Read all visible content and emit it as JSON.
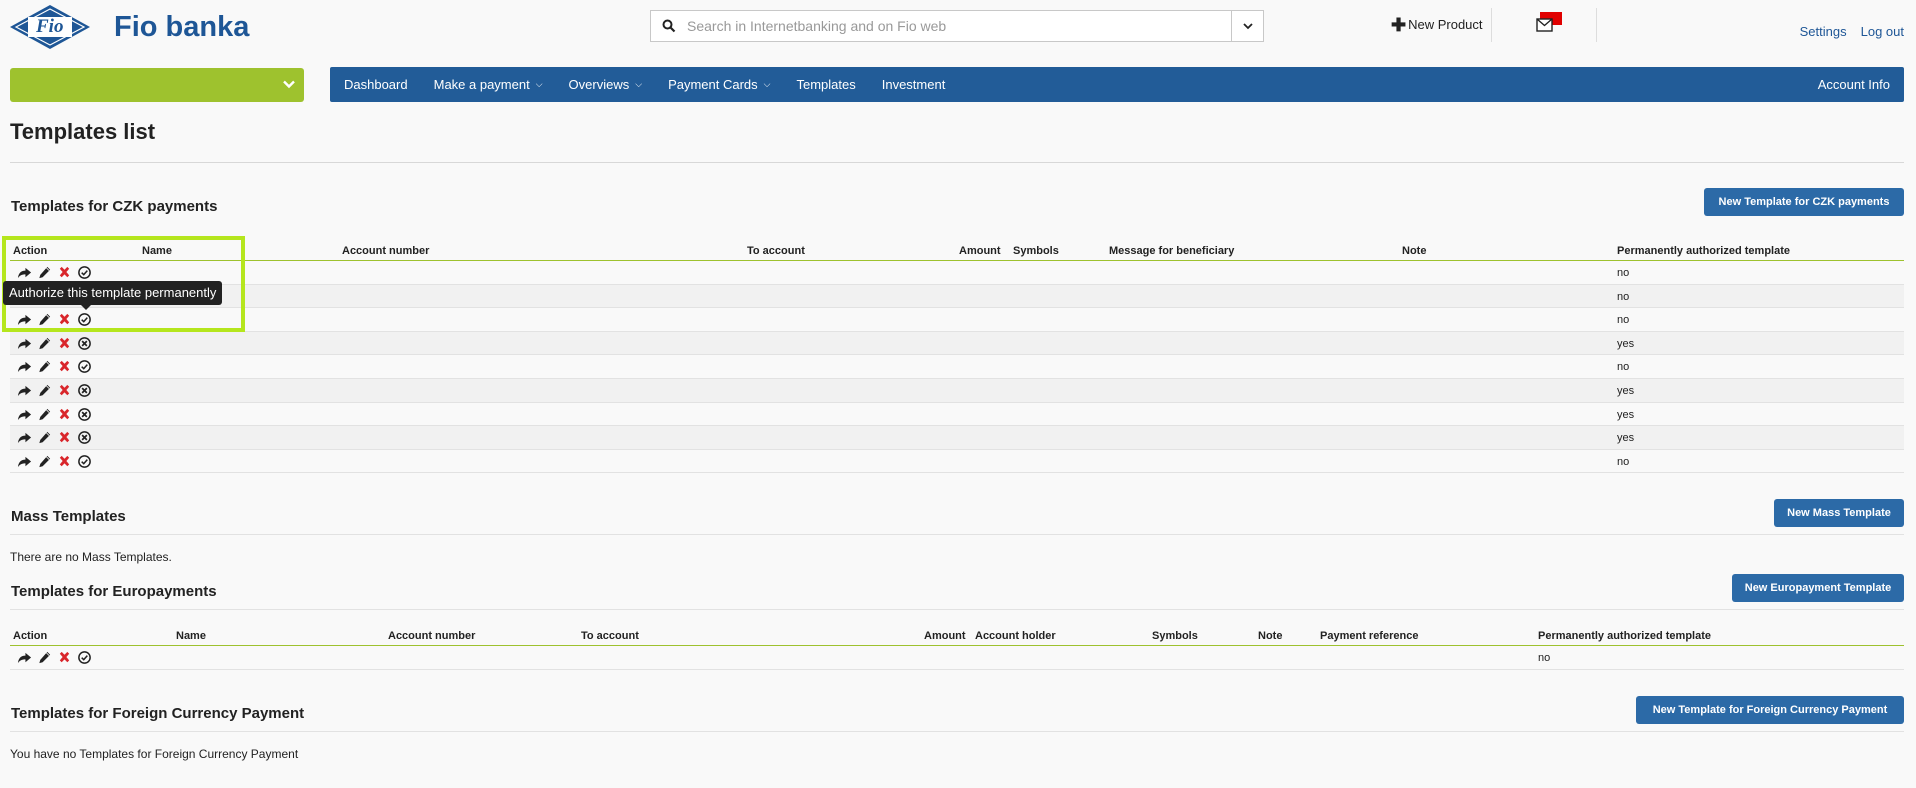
{
  "header": {
    "brand": "Fio banka",
    "logo_text": "Fio",
    "search_placeholder": "Search in Internetbanking and on Fio web",
    "new_product": "New Product",
    "settings": "Settings",
    "logout": "Log out"
  },
  "nav": {
    "items": [
      "Dashboard",
      "Make a payment",
      "Overviews",
      "Payment Cards",
      "Templates",
      "Investment"
    ],
    "account_info": "Account Info"
  },
  "page_title": "Templates list",
  "czk": {
    "title": "Templates for CZK payments",
    "new_button": "New Template for CZK payments",
    "columns": [
      "Action",
      "Name",
      "Account number",
      "To account",
      "Amount",
      "Symbols",
      "Message for beneficiary",
      "Note",
      "Permanently authorized template"
    ],
    "rows": [
      {
        "perm": "no",
        "authorized": false
      },
      {
        "perm": "no",
        "authorized": false
      },
      {
        "perm": "no",
        "authorized": false
      },
      {
        "perm": "yes",
        "authorized": true
      },
      {
        "perm": "no",
        "authorized": false
      },
      {
        "perm": "yes",
        "authorized": true
      },
      {
        "perm": "yes",
        "authorized": true
      },
      {
        "perm": "yes",
        "authorized": true
      },
      {
        "perm": "no",
        "authorized": false
      }
    ],
    "tooltip": "Authorize this template permanently"
  },
  "mass": {
    "title": "Mass Templates",
    "new_button": "New Mass Template",
    "empty": "There are no Mass Templates."
  },
  "euro": {
    "title": "Templates for Europayments",
    "new_button": "New Europayment Template",
    "columns": [
      "Action",
      "Name",
      "Account number",
      "To account",
      "Amount",
      "Account holder",
      "Symbols",
      "Note",
      "Payment reference",
      "Permanently authorized template"
    ],
    "rows": [
      {
        "perm": "no"
      }
    ]
  },
  "foreign": {
    "title": "Templates for Foreign Currency Payment",
    "new_button": "New Template for Foreign Currency Payment",
    "empty": "You have no Templates for Foreign Currency Payment"
  },
  "colors": {
    "brand_blue": "#225c98",
    "accent_green": "#9ec22e",
    "button_blue": "#2c6aa7",
    "highlight": "#b5e61d",
    "delete_red": "#d9262b"
  }
}
